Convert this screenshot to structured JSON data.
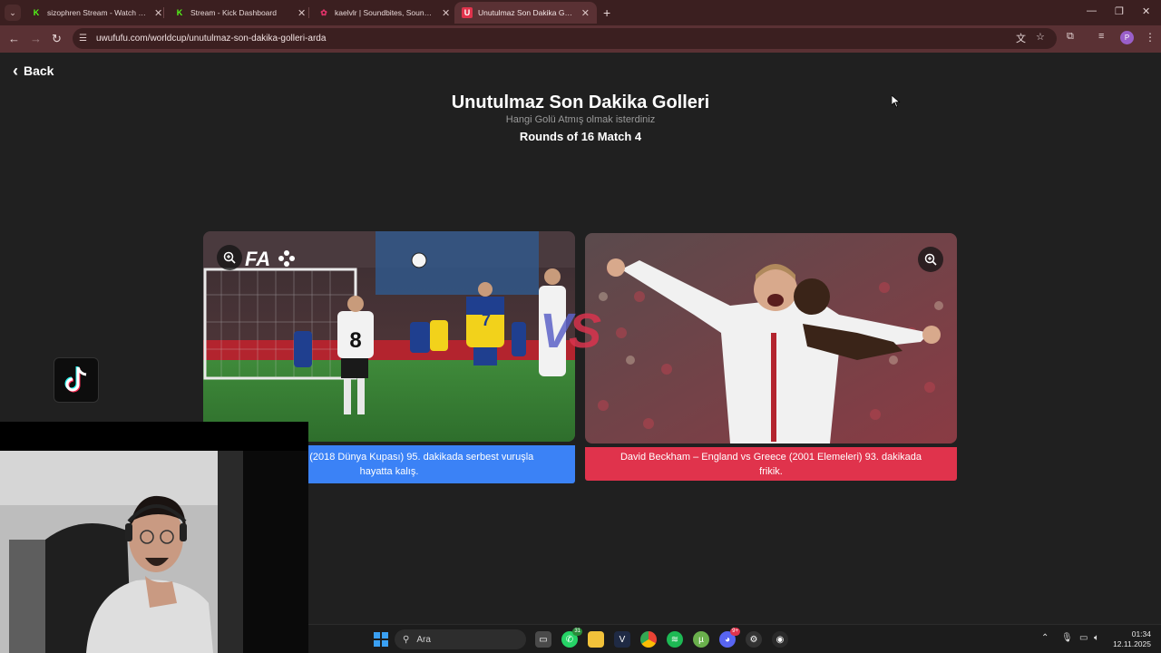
{
  "browser": {
    "tabs": [
      {
        "title": "sizophren Stream - Watch Live",
        "favicon": "kick-icon",
        "color": "#53fc18"
      },
      {
        "title": "Stream - Kick Dashboard",
        "favicon": "kick-icon",
        "color": "#53fc18"
      },
      {
        "title": "kaelvlr | Soundbites, Sounds M",
        "favicon": "soundbites-icon",
        "color": "#e0336a"
      },
      {
        "title": "Unutulmaz Son Dakika Golleri |",
        "favicon": "uwufufu-icon",
        "color": "#e0334c"
      }
    ],
    "url": "uwufufu.com/worldcup/unutulmaz-son-dakika-golleri-arda",
    "profile_initial": "P"
  },
  "page": {
    "back_label": "Back",
    "title": "Unutulmaz Son Dakika Golleri",
    "subtitle": "Hangi Golü Atmış olmak isterdiniz",
    "round": "Rounds of 16 Match 4",
    "vs_v": "V",
    "vs_s": "S",
    "left": {
      "caption": "ny vs Sweden (2018 Dünya Kupası) 95. dakikada serbest vuruşla hayatta kalış.",
      "color": "#3b82f6",
      "overlay_logo": "FA"
    },
    "right": {
      "caption": "David Beckham – England vs Greece (2001 Elemeleri) 93. dakikada frikik.",
      "color": "#e0334c"
    }
  },
  "taskbar": {
    "search_placeholder": "Ara",
    "whatsapp_badge": "31",
    "discord_badge": "9+",
    "time": "01:34",
    "date": "12.11.2025"
  }
}
